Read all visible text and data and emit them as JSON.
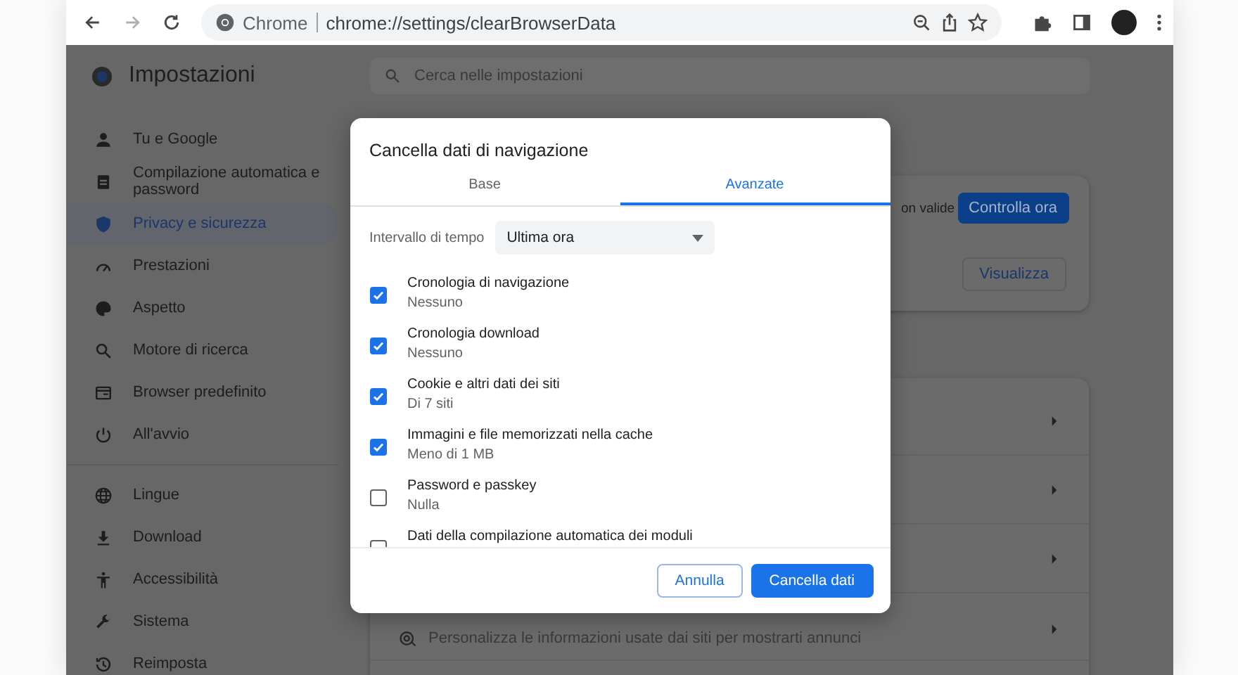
{
  "toolbar": {
    "back": {
      "disabled": false
    },
    "forward": {
      "disabled": true
    },
    "site_label": "Chrome",
    "url": "chrome://settings/clearBrowserData"
  },
  "settings": {
    "title": "Impostazioni",
    "search": {
      "placeholder": "Cerca nelle impostazioni"
    },
    "sidebar": {
      "groups": [
        {
          "items": [
            {
              "label": "Tu e Google",
              "selected": false
            },
            {
              "label": "Compilazione automatica e password",
              "selected": false
            },
            {
              "label": "Privacy e sicurezza",
              "selected": true
            },
            {
              "label": "Prestazioni",
              "selected": false
            },
            {
              "label": "Aspetto",
              "selected": false
            },
            {
              "label": "Motore di ricerca",
              "selected": false
            },
            {
              "label": "Browser predefinito",
              "selected": false
            },
            {
              "label": "All'avvio",
              "selected": false
            }
          ]
        },
        {
          "items": [
            {
              "label": "Lingue",
              "selected": false
            },
            {
              "label": "Download",
              "selected": false
            },
            {
              "label": "Accessibilità",
              "selected": false
            },
            {
              "label": "Sistema",
              "selected": false
            },
            {
              "label": "Reimposta",
              "selected": false
            }
          ]
        }
      ]
    },
    "safety_card": {
      "status_fragment": "on valide",
      "check_button": "Controlla ora",
      "view_button": "Visualizza"
    },
    "privacy_card": {
      "ads_description": "Personalizza le informazioni usate dai siti per mostrarti annunci"
    }
  },
  "dialog": {
    "title": "Cancella dati di navigazione",
    "tabs": [
      {
        "label": "Base",
        "selected": false
      },
      {
        "label": "Avanzate",
        "selected": true
      }
    ],
    "time_range": {
      "label": "Intervallo di tempo",
      "value": "Ultima ora"
    },
    "items": [
      {
        "title": "Cronologia di navigazione",
        "detail": "Nessuno",
        "checked": true
      },
      {
        "title": "Cronologia download",
        "detail": "Nessuno",
        "checked": true
      },
      {
        "title": "Cookie e altri dati dei siti",
        "detail": "Di 7 siti",
        "checked": true
      },
      {
        "title": "Immagini e file memorizzati nella cache",
        "detail": "Meno di 1 MB",
        "checked": true
      },
      {
        "title": "Password e passkey",
        "detail": "Nulla",
        "checked": false
      },
      {
        "title": "Dati della compilazione automatica dei moduli",
        "checked": false
      }
    ],
    "buttons": [
      {
        "label": "Annulla",
        "kind": "secondary"
      },
      {
        "label": "Cancella dati",
        "kind": "primary"
      }
    ]
  }
}
